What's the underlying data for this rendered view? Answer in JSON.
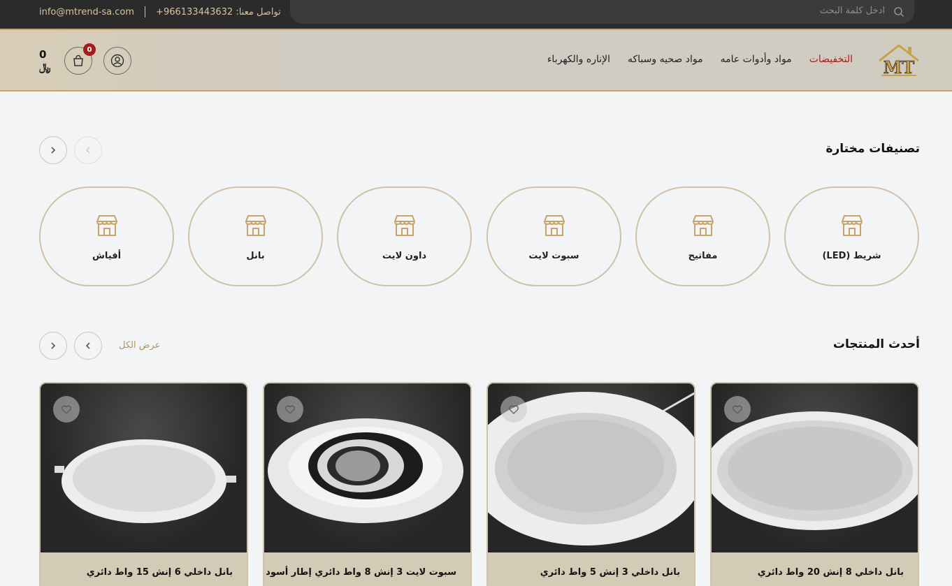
{
  "topbar": {
    "search_placeholder": "ادخل كلمة البحث",
    "phone": "تواصل معنا: 966133443632+",
    "email": "info@mtrend-sa.com"
  },
  "header": {
    "logo_text": "MT",
    "nav": [
      "الإناره والكهرباء",
      "مواد صحيه وسباكه",
      "مواد وأدوات عامه",
      "التخفيضات"
    ],
    "cart_count": "0",
    "cart_total": "0 ﷼"
  },
  "categories": {
    "title": "تصنيفات مختارة",
    "items": [
      "شريط (LED)",
      "مفاتيح",
      "سبوت لايت",
      "داون لايت",
      "بانل",
      "أفياش"
    ]
  },
  "products": {
    "title": "أحدث المنتجات",
    "view_all": "عرض الكل",
    "items": [
      {
        "name": "بانل داخلي 8 إنش 20 واط دائري"
      },
      {
        "name": "بانل داخلي 3 إنش 5 واط دائري"
      },
      {
        "name": "سبوت لايت 3 إنش 8 واط دائري إطار أسود"
      },
      {
        "name": "بانل داخلي 6 إنش 15 واط دائري"
      }
    ]
  },
  "colors": {
    "accent_gold": "#c9a46a",
    "sale_red": "#a31d1d",
    "topbar_bg": "#2b2b2b"
  }
}
